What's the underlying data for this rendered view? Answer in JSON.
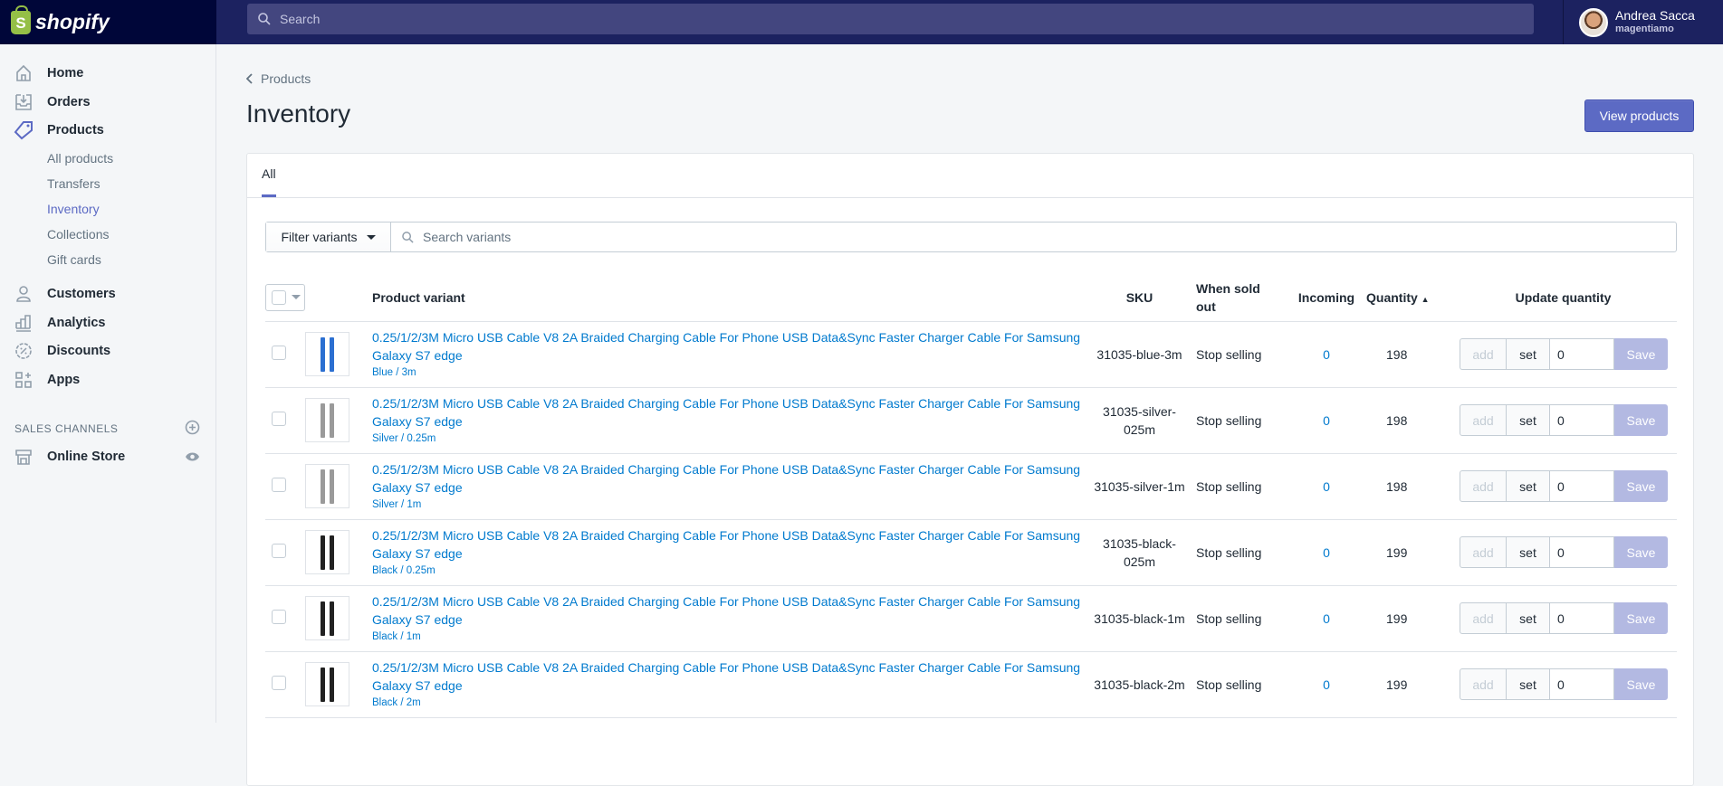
{
  "topbar": {
    "logo_text": "shopify",
    "search_placeholder": "Search",
    "user_name": "Andrea Sacca",
    "store_name": "magentiamo"
  },
  "sidebar": {
    "items": [
      {
        "label": "Home"
      },
      {
        "label": "Orders"
      },
      {
        "label": "Products"
      }
    ],
    "product_sub": [
      {
        "label": "All products"
      },
      {
        "label": "Transfers"
      },
      {
        "label": "Inventory",
        "active": true
      },
      {
        "label": "Collections"
      },
      {
        "label": "Gift cards"
      }
    ],
    "items2": [
      {
        "label": "Customers"
      },
      {
        "label": "Analytics"
      },
      {
        "label": "Discounts"
      },
      {
        "label": "Apps"
      }
    ],
    "sales_channels_title": "SALES CHANNELS",
    "online_store": "Online Store"
  },
  "page": {
    "breadcrumb": "Products",
    "title": "Inventory",
    "view_products": "View products"
  },
  "tabs": {
    "all": "All"
  },
  "filter": {
    "button": "Filter variants",
    "search_placeholder": "Search variants"
  },
  "table": {
    "headers": {
      "product": "Product variant",
      "sku": "SKU",
      "sold_out": "When sold out",
      "incoming": "Incoming",
      "quantity": "Quantity",
      "update": "Update quantity"
    },
    "buttons": {
      "add": "add",
      "set": "set",
      "save": "Save"
    },
    "rows": [
      {
        "title": "0.25/1/2/3M Micro USB Cable V8 2A Braided Charging Cable For Phone USB Data&Sync Faster Charger Cable For Samsung Galaxy S7 edge",
        "variant": "Blue / 3m",
        "sku": "31035-blue-3m",
        "sold_out": "Stop selling",
        "incoming": "0",
        "quantity": "198",
        "input": "0",
        "color": "#2b6fd1"
      },
      {
        "title": "0.25/1/2/3M Micro USB Cable V8 2A Braided Charging Cable For Phone USB Data&Sync Faster Charger Cable For Samsung Galaxy S7 edge",
        "variant": "Silver / 0.25m",
        "sku": "31035-silver-025m",
        "sold_out": "Stop selling",
        "incoming": "0",
        "quantity": "198",
        "input": "0",
        "color": "#9a9a9a"
      },
      {
        "title": "0.25/1/2/3M Micro USB Cable V8 2A Braided Charging Cable For Phone USB Data&Sync Faster Charger Cable For Samsung Galaxy S7 edge",
        "variant": "Silver / 1m",
        "sku": "31035-silver-1m",
        "sold_out": "Stop selling",
        "incoming": "0",
        "quantity": "198",
        "input": "0",
        "color": "#9a9a9a"
      },
      {
        "title": "0.25/1/2/3M Micro USB Cable V8 2A Braided Charging Cable For Phone USB Data&Sync Faster Charger Cable For Samsung Galaxy S7 edge",
        "variant": "Black / 0.25m",
        "sku": "31035-black-025m",
        "sold_out": "Stop selling",
        "incoming": "0",
        "quantity": "199",
        "input": "0",
        "color": "#222222"
      },
      {
        "title": "0.25/1/2/3M Micro USB Cable V8 2A Braided Charging Cable For Phone USB Data&Sync Faster Charger Cable For Samsung Galaxy S7 edge",
        "variant": "Black / 1m",
        "sku": "31035-black-1m",
        "sold_out": "Stop selling",
        "incoming": "0",
        "quantity": "199",
        "input": "0",
        "color": "#222222"
      },
      {
        "title": "0.25/1/2/3M Micro USB Cable V8 2A Braided Charging Cable For Phone USB Data&Sync Faster Charger Cable For Samsung Galaxy S7 edge",
        "variant": "Black / 2m",
        "sku": "31035-black-2m",
        "sold_out": "Stop selling",
        "incoming": "0",
        "quantity": "199",
        "input": "0",
        "color": "#222222"
      }
    ]
  }
}
